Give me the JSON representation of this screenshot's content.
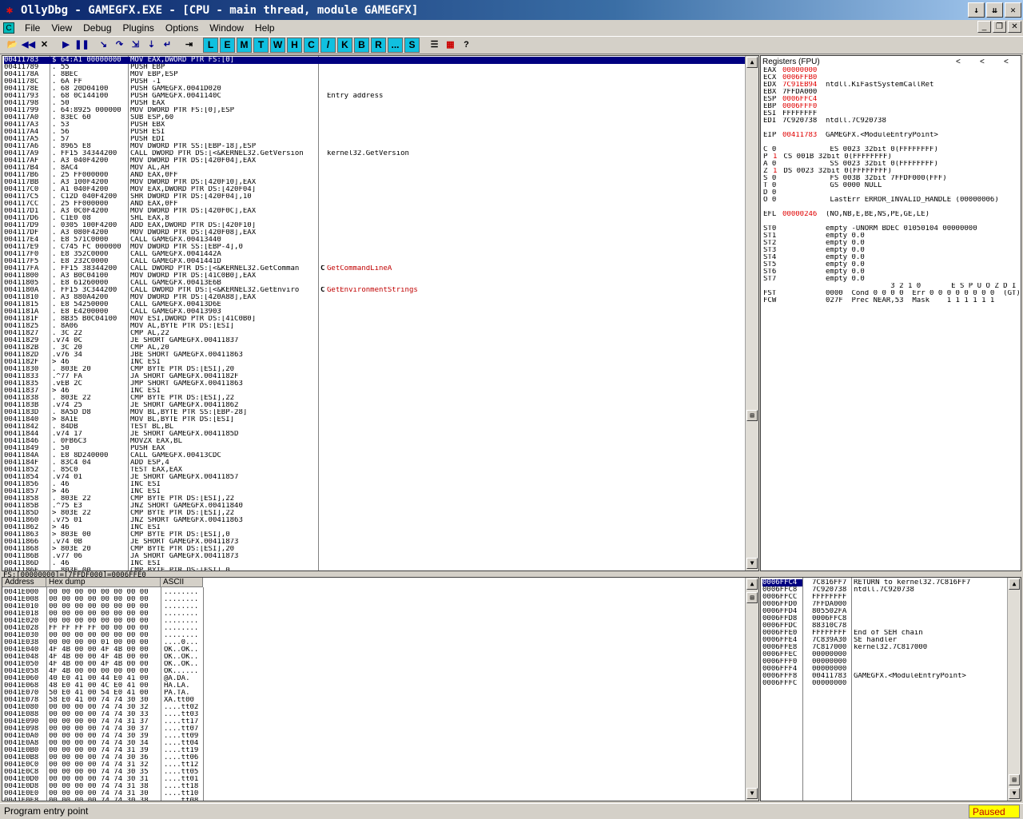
{
  "title": "OllyDbg - GAMEGFX.EXE - [CPU - main thread, module GAMEGFX]",
  "menu": [
    "File",
    "View",
    "Debug",
    "Plugins",
    "Options",
    "Window",
    "Help"
  ],
  "letters": [
    "L",
    "E",
    "M",
    "T",
    "W",
    "H",
    "C",
    "/",
    "K",
    "B",
    "R",
    "...",
    "S"
  ],
  "disasm": [
    {
      "a": "00411783",
      "h": "$ 64:A1 00000000",
      "i": "MOV EAX,DWORD PTR FS:[0]",
      "c": ""
    },
    {
      "a": "00411789",
      "h": ". 55",
      "i": "PUSH EBP",
      "c": ""
    },
    {
      "a": "0041178A",
      "h": ". 8BEC",
      "i": "MOV EBP,ESP",
      "c": ""
    },
    {
      "a": "0041178C",
      "h": ". 6A FF",
      "i": "PUSH -1",
      "c": ""
    },
    {
      "a": "0041178E",
      "h": ". 68 20D04100",
      "i": "PUSH GAMEGFX.0041D020",
      "c": ""
    },
    {
      "a": "00411793",
      "h": ". 68 0C144100",
      "i": "PUSH GAMEGFX.0041140C",
      "c": "Entry address"
    },
    {
      "a": "00411798",
      "h": ". 50",
      "i": "PUSH EAX",
      "c": ""
    },
    {
      "a": "00411799",
      "h": ". 64:8925 000000",
      "i": "MOV DWORD PTR FS:[0],ESP",
      "c": ""
    },
    {
      "a": "004117A0",
      "h": ". 83EC 60",
      "i": "SUB ESP,60",
      "c": ""
    },
    {
      "a": "004117A3",
      "h": ". 53",
      "i": "PUSH EBX",
      "c": ""
    },
    {
      "a": "004117A4",
      "h": ". 56",
      "i": "PUSH ESI",
      "c": ""
    },
    {
      "a": "004117A5",
      "h": ". 57",
      "i": "PUSH EDI",
      "c": ""
    },
    {
      "a": "004117A6",
      "h": ". 8965 E8",
      "i": "MOV DWORD PTR SS:[EBP-18],ESP",
      "c": ""
    },
    {
      "a": "004117A9",
      "h": ". FF15 34344200",
      "i": "CALL DWORD PTR DS:[<&KERNEL32.GetVersion",
      "c": "kernel32.GetVersion"
    },
    {
      "a": "004117AF",
      "h": ". A3 040F4200",
      "i": "MOV DWORD PTR DS:[420F04],EAX",
      "c": ""
    },
    {
      "a": "004117B4",
      "h": ". 8AC4",
      "i": "MOV AL,AH",
      "c": ""
    },
    {
      "a": "004117B6",
      "h": ". 25 FF000000",
      "i": "AND EAX,0FF",
      "c": ""
    },
    {
      "a": "004117BB",
      "h": ". A3 100F4200",
      "i": "MOV DWORD PTR DS:[420F10],EAX",
      "c": ""
    },
    {
      "a": "004117C0",
      "h": ". A1 040F4200",
      "i": "MOV EAX,DWORD PTR DS:[420F04]",
      "c": ""
    },
    {
      "a": "004117C5",
      "h": ". C12D 040F4200",
      "i": "SHR DWORD PTR DS:[420F04],10",
      "c": ""
    },
    {
      "a": "004117CC",
      "h": ". 25 FF000000",
      "i": "AND EAX,0FF",
      "c": ""
    },
    {
      "a": "004117D1",
      "h": ". A3 0C0F4200",
      "i": "MOV DWORD PTR DS:[420F0C],EAX",
      "c": ""
    },
    {
      "a": "004117D6",
      "h": ". C1E0 08",
      "i": "SHL EAX,8",
      "c": ""
    },
    {
      "a": "004117D9",
      "h": ". 0305 100F4200",
      "i": "ADD EAX,DWORD PTR DS:[420F10]",
      "c": ""
    },
    {
      "a": "004117DF",
      "h": ". A3 080F4200",
      "i": "MOV DWORD PTR DS:[420F08],EAX",
      "c": ""
    },
    {
      "a": "004117E4",
      "h": ". E8 571C0000",
      "i": "CALL GAMEGFX.00413440",
      "c": ""
    },
    {
      "a": "004117E9",
      "h": ". C745 FC 000000",
      "i": "MOV DWORD PTR SS:[EBP-4],0",
      "c": ""
    },
    {
      "a": "004117F0",
      "h": ". E8 352C0000",
      "i": "CALL GAMEGFX.0041442A",
      "c": ""
    },
    {
      "a": "004117F5",
      "h": ". E8 232C0000",
      "i": "CALL GAMEGFX.0041441D",
      "c": ""
    },
    {
      "a": "004117FA",
      "h": ". FF15 38344200",
      "i": "CALL DWORD PTR DS:[<&KERNEL32.GetComman",
      "c": "GetCommandLineA",
      "ca": true
    },
    {
      "a": "00411800",
      "h": ". A3 B0C04100",
      "i": "MOV DWORD PTR DS:[41C0B0],EAX",
      "c": ""
    },
    {
      "a": "00411805",
      "h": ". E8 61260000",
      "i": "CALL GAMEGFX.00413E6B",
      "c": ""
    },
    {
      "a": "0041180A",
      "h": ". FF15 3C344200",
      "i": "CALL DWORD PTR DS:[<&KERNEL32.GetEnviro",
      "c": "GetEnvironmentStrings",
      "ca": true
    },
    {
      "a": "00411810",
      "h": ". A3 880A4200",
      "i": "MOV DWORD PTR DS:[420A88],EAX",
      "c": ""
    },
    {
      "a": "00411815",
      "h": ". E8 54250000",
      "i": "CALL GAMEGFX.00413D6E",
      "c": ""
    },
    {
      "a": "0041181A",
      "h": ". E8 E4200000",
      "i": "CALL GAMEGFX.00413903",
      "c": ""
    },
    {
      "a": "0041181F",
      "h": ". 8B35 B0C04100",
      "i": "MOV ESI,DWORD PTR DS:[41C0B0]",
      "c": ""
    },
    {
      "a": "00411825",
      "h": ". 8A06",
      "i": "MOV AL,BYTE PTR DS:[ESI]",
      "c": ""
    },
    {
      "a": "00411827",
      "h": ". 3C 22",
      "i": "CMP AL,22",
      "c": ""
    },
    {
      "a": "00411829",
      "h": ".v74 0C",
      "i": "JE SHORT GAMEGFX.00411837",
      "c": ""
    },
    {
      "a": "0041182B",
      "h": ". 3C 20",
      "i": "CMP AL,20",
      "c": ""
    },
    {
      "a": "0041182D",
      "h": ".v76 34",
      "i": "JBE SHORT GAMEGFX.00411863",
      "c": ""
    },
    {
      "a": "0041182F",
      "h": "> 46",
      "i": "INC ESI",
      "c": ""
    },
    {
      "a": "00411830",
      "h": ". 803E 20",
      "i": "CMP BYTE PTR DS:[ESI],20",
      "c": ""
    },
    {
      "a": "00411833",
      "h": ".^77 FA",
      "i": "JA SHORT GAMEGFX.0041182F",
      "c": ""
    },
    {
      "a": "00411835",
      "h": ".vEB 2C",
      "i": "JMP SHORT GAMEGFX.00411863",
      "c": ""
    },
    {
      "a": "00411837",
      "h": "> 46",
      "i": "INC ESI",
      "c": ""
    },
    {
      "a": "00411838",
      "h": ". 803E 22",
      "i": "CMP BYTE PTR DS:[ESI],22",
      "c": ""
    },
    {
      "a": "0041183B",
      "h": ".v74 25",
      "i": "JE SHORT GAMEGFX.00411862",
      "c": ""
    },
    {
      "a": "0041183D",
      "h": ". 8A5D D8",
      "i": "MOV BL,BYTE PTR SS:[EBP-28]",
      "c": ""
    },
    {
      "a": "00411840",
      "h": "> 8A1E",
      "i": "MOV BL,BYTE PTR DS:[ESI]",
      "c": ""
    },
    {
      "a": "00411842",
      "h": ". 84DB",
      "i": "TEST BL,BL",
      "c": ""
    },
    {
      "a": "00411844",
      "h": ".v74 17",
      "i": "JE SHORT GAMEGFX.0041185D",
      "c": ""
    },
    {
      "a": "00411846",
      "h": ". 0FB6C3",
      "i": "MOVZX EAX,BL",
      "c": ""
    },
    {
      "a": "00411849",
      "h": ". 50",
      "i": "PUSH EAX",
      "c": ""
    },
    {
      "a": "0041184A",
      "h": ". E8 8D240000",
      "i": "CALL GAMEGFX.00413CDC",
      "c": ""
    },
    {
      "a": "0041184F",
      "h": ". 83C4 04",
      "i": "ADD ESP,4",
      "c": ""
    },
    {
      "a": "00411852",
      "h": ". 85C0",
      "i": "TEST EAX,EAX",
      "c": ""
    },
    {
      "a": "00411854",
      "h": ".v74 01",
      "i": "JE SHORT GAMEGFX.00411857",
      "c": ""
    },
    {
      "a": "00411856",
      "h": ". 46",
      "i": "INC ESI",
      "c": ""
    },
    {
      "a": "00411857",
      "h": "> 46",
      "i": "INC ESI",
      "c": ""
    },
    {
      "a": "00411858",
      "h": ". 803E 22",
      "i": "CMP BYTE PTR DS:[ESI],22",
      "c": ""
    },
    {
      "a": "0041185B",
      "h": ".^75 E3",
      "i": "JNZ SHORT GAMEGFX.00411840",
      "c": ""
    },
    {
      "a": "0041185D",
      "h": "> 803E 22",
      "i": "CMP BYTE PTR DS:[ESI],22",
      "c": ""
    },
    {
      "a": "00411860",
      "h": ".v75 01",
      "i": "JNZ SHORT GAMEGFX.00411863",
      "c": ""
    },
    {
      "a": "00411862",
      "h": "> 46",
      "i": "INC ESI",
      "c": ""
    },
    {
      "a": "00411863",
      "h": "> 803E 00",
      "i": "CMP BYTE PTR DS:[ESI],0",
      "c": ""
    },
    {
      "a": "00411866",
      "h": ".v74 0B",
      "i": "JE SHORT GAMEGFX.00411873",
      "c": ""
    },
    {
      "a": "00411868",
      "h": "> 803E 20",
      "i": "CMP BYTE PTR DS:[ESI],20",
      "c": ""
    },
    {
      "a": "0041186B",
      "h": ".v77 06",
      "i": "JA SHORT GAMEGFX.00411873",
      "c": ""
    },
    {
      "a": "0041186D",
      "h": ". 46",
      "i": "INC ESI",
      "c": ""
    },
    {
      "a": "0041186E",
      "h": ". 803E 00",
      "i": "CMP BYTE PTR DS:[ESI],0",
      "c": ""
    }
  ],
  "info_line": "FS:[00000000]=[7FFDF000]=0006FFE0",
  "regs": {
    "title": "Registers (FPU)",
    "nav": [
      "<",
      "<",
      "<"
    ],
    "lines": [
      {
        "n": "EAX",
        "v": "00000000",
        "r": true,
        "c": ""
      },
      {
        "n": "ECX",
        "v": "0006FFB0",
        "r": true,
        "c": ""
      },
      {
        "n": "EDX",
        "v": "7C91EB94",
        "r": true,
        "c": "ntdll.KiFastSystemCallRet"
      },
      {
        "n": "EBX",
        "v": "7FFDA000",
        "r": false,
        "c": ""
      },
      {
        "n": "ESP",
        "v": "0006FFC4",
        "r": true,
        "c": ""
      },
      {
        "n": "EBP",
        "v": "0006FFF0",
        "r": true,
        "c": ""
      },
      {
        "n": "ESI",
        "v": "FFFFFFFF",
        "r": false,
        "c": ""
      },
      {
        "n": "EDI",
        "v": "7C920738",
        "r": false,
        "c": "ntdll.7C920738"
      },
      {
        "gap": true
      },
      {
        "n": "EIP",
        "v": "00411783",
        "r": true,
        "c": "GAMEGFX.<ModuleEntryPoint>"
      },
      {
        "gap": true
      },
      {
        "n": "C 0",
        "v": "",
        "r": false,
        "c": " ES 0023 32bit 0(FFFFFFFF)"
      },
      {
        "n": "P",
        "v": "1",
        "r": true,
        "c": " CS 001B 32bit 0(FFFFFFFF)"
      },
      {
        "n": "A 0",
        "v": "",
        "r": false,
        "c": " SS 0023 32bit 0(FFFFFFFF)"
      },
      {
        "n": "Z",
        "v": "1",
        "r": true,
        "c": " DS 0023 32bit 0(FFFFFFFF)"
      },
      {
        "n": "S 0",
        "v": "",
        "r": false,
        "c": " FS 003B 32bit 7FFDF000(FFF)"
      },
      {
        "n": "T 0",
        "v": "",
        "r": false,
        "c": " GS 0000 NULL"
      },
      {
        "n": "D 0",
        "v": "",
        "r": false,
        "c": ""
      },
      {
        "n": "O 0",
        "v": "",
        "r": false,
        "c": " LastErr ERROR_INVALID_HANDLE (00000006)"
      },
      {
        "gap": true
      },
      {
        "n": "EFL",
        "v": "00000246",
        "r": true,
        "c": "(NO,NB,E,BE,NS,PE,GE,LE)"
      },
      {
        "gap": true
      },
      {
        "n": "ST0",
        "v": "",
        "r": false,
        "c": "empty -UNORM BDEC 01050104 00000000"
      },
      {
        "n": "ST1",
        "v": "",
        "r": false,
        "c": "empty 0.0"
      },
      {
        "n": "ST2",
        "v": "",
        "r": false,
        "c": "empty 0.0"
      },
      {
        "n": "ST3",
        "v": "",
        "r": false,
        "c": "empty 0.0"
      },
      {
        "n": "ST4",
        "v": "",
        "r": false,
        "c": "empty 0.0"
      },
      {
        "n": "ST5",
        "v": "",
        "r": false,
        "c": "empty 0.0"
      },
      {
        "n": "ST6",
        "v": "",
        "r": false,
        "c": "empty 0.0"
      },
      {
        "n": "ST7",
        "v": "",
        "r": false,
        "c": "empty 0.0"
      },
      {
        "n": "",
        "v": "",
        "r": false,
        "c": "               3 2 1 0       E S P U O Z D I"
      },
      {
        "n": "FST",
        "v": "",
        "r": false,
        "c": "0000  Cond 0 0 0 0  Err 0 0 0 0 0 0 0 0  (GT)"
      },
      {
        "n": "FCW",
        "v": "",
        "r": false,
        "c": "027F  Prec NEAR,53  Mask    1 1 1 1 1 1"
      }
    ]
  },
  "dump": {
    "headers": [
      "Address",
      "Hex dump",
      "ASCII"
    ],
    "rows": [
      {
        "a": "0041E000",
        "h": "00 00 00 00 00 00 00 00",
        "s": "........"
      },
      {
        "a": "0041E008",
        "h": "00 00 00 00 00 00 00 00",
        "s": "........"
      },
      {
        "a": "0041E010",
        "h": "00 00 00 00 00 00 00 00",
        "s": "........"
      },
      {
        "a": "0041E018",
        "h": "00 00 00 00 00 00 00 00",
        "s": "........"
      },
      {
        "a": "0041E020",
        "h": "00 00 00 00 00 00 00 00",
        "s": "........"
      },
      {
        "a": "0041E028",
        "h": "FF FF FF FF 00 00 00 00",
        "s": "........"
      },
      {
        "a": "0041E030",
        "h": "00 00 00 00 00 00 00 00",
        "s": "........"
      },
      {
        "a": "0041E038",
        "h": "00 00 00 00 01 00 00 00",
        "s": "....0..."
      },
      {
        "a": "0041E040",
        "h": "4F 4B 00 00 4F 4B 00 00",
        "s": "OK..OK.."
      },
      {
        "a": "0041E048",
        "h": "4F 4B 00 00 4F 4B 00 00",
        "s": "OK..OK.."
      },
      {
        "a": "0041E050",
        "h": "4F 4B 00 00 4F 4B 00 00",
        "s": "OK..OK.."
      },
      {
        "a": "0041E058",
        "h": "4F 4B 00 00 00 00 00 00",
        "s": "OK......"
      },
      {
        "a": "0041E060",
        "h": "40 E0 41 00 44 E0 41 00",
        "s": "@A.DA."
      },
      {
        "a": "0041E068",
        "h": "48 E0 41 00 4C E0 41 00",
        "s": "HA.LA."
      },
      {
        "a": "0041E070",
        "h": "50 E0 41 00 54 E0 41 00",
        "s": "PA.TA."
      },
      {
        "a": "0041E078",
        "h": "58 E0 41 00 74 74 30 30",
        "s": "XA.tt00"
      },
      {
        "a": "0041E080",
        "h": "00 00 00 00 74 74 30 32",
        "s": "....tt02"
      },
      {
        "a": "0041E088",
        "h": "00 00 00 00 74 74 30 33",
        "s": "....tt03"
      },
      {
        "a": "0041E090",
        "h": "00 00 00 00 74 74 31 37",
        "s": "....tt17"
      },
      {
        "a": "0041E098",
        "h": "00 00 00 00 74 74 30 37",
        "s": "....tt07"
      },
      {
        "a": "0041E0A0",
        "h": "00 00 00 00 74 74 30 39",
        "s": "....tt09"
      },
      {
        "a": "0041E0A8",
        "h": "00 00 00 00 74 74 30 34",
        "s": "....tt04"
      },
      {
        "a": "0041E0B0",
        "h": "00 00 00 00 74 74 31 39",
        "s": "....tt19"
      },
      {
        "a": "0041E0B8",
        "h": "00 00 00 00 74 74 30 36",
        "s": "....tt06"
      },
      {
        "a": "0041E0C0",
        "h": "00 00 00 00 74 74 31 32",
        "s": "....tt12"
      },
      {
        "a": "0041E0C8",
        "h": "00 00 00 00 74 74 30 35",
        "s": "....tt05"
      },
      {
        "a": "0041E0D0",
        "h": "00 00 00 00 74 74 30 31",
        "s": "....tt01"
      },
      {
        "a": "0041E0D8",
        "h": "00 00 00 00 74 74 31 38",
        "s": "....tt18"
      },
      {
        "a": "0041E0E0",
        "h": "00 00 00 00 74 74 31 30",
        "s": "....tt10"
      },
      {
        "a": "0041E0E8",
        "h": "00 00 00 00 74 74 30 38",
        "s": "....tt08"
      }
    ]
  },
  "stack": [
    {
      "a": "0006FFC4",
      "v": "7C816FF7",
      "c": "RETURN to kernel32.7C816FF7",
      "hl": true
    },
    {
      "a": "0006FFC8",
      "v": "7C920738",
      "c": "ntdll.7C920738"
    },
    {
      "a": "0006FFCC",
      "v": "FFFFFFFF",
      "c": ""
    },
    {
      "a": "0006FFD0",
      "v": "7FFDA000",
      "c": ""
    },
    {
      "a": "0006FFD4",
      "v": "805502FA",
      "c": ""
    },
    {
      "a": "0006FFD8",
      "v": "0006FFC8",
      "c": ""
    },
    {
      "a": "0006FFDC",
      "v": "88310C78",
      "c": ""
    },
    {
      "a": "0006FFE0",
      "v": "FFFFFFFF",
      "c": "End of SEH chain"
    },
    {
      "a": "0006FFE4",
      "v": "7C839A30",
      "c": "SE handler"
    },
    {
      "a": "0006FFE8",
      "v": "7C817000",
      "c": "kernel32.7C817000"
    },
    {
      "a": "0006FFEC",
      "v": "00000000",
      "c": ""
    },
    {
      "a": "0006FFF0",
      "v": "00000000",
      "c": ""
    },
    {
      "a": "0006FFF4",
      "v": "00000000",
      "c": ""
    },
    {
      "a": "0006FFF8",
      "v": "00411783",
      "c": "GAMEGFX.<ModuleEntryPoint>"
    },
    {
      "a": "0006FFFC",
      "v": "00000000",
      "c": ""
    }
  ],
  "status": "Program entry point",
  "status_right": "Paused"
}
